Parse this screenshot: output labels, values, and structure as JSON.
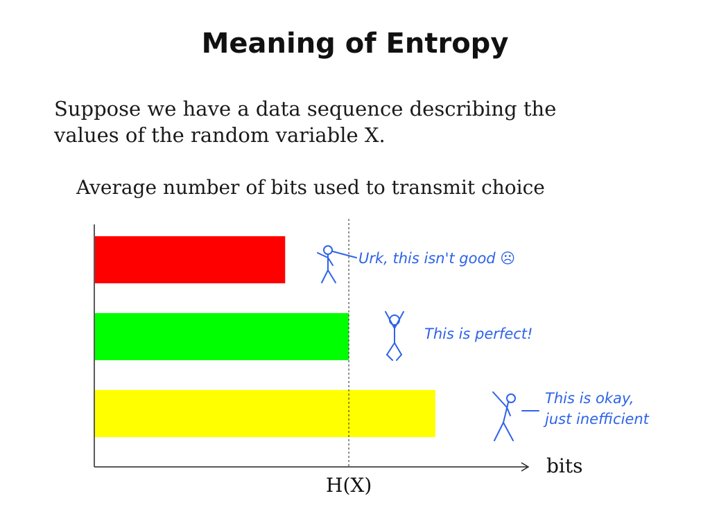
{
  "slide": {
    "title": "Meaning of Entropy",
    "intro_lines": [
      "Suppose we have a data sequence describing the",
      "values of the random variable X."
    ]
  },
  "chart_data": {
    "type": "bar",
    "orientation": "horizontal",
    "title": "Average number of bits used to transmit choice",
    "xlabel": "bits",
    "ylabel": "",
    "xlim": [
      0,
      1.7
    ],
    "reference_line": {
      "label": "H(X)",
      "value": 1.0,
      "style": "dashed"
    },
    "bars": [
      {
        "value": 0.75,
        "color": "#ff0000",
        "annotation": [
          "Urk, this isn't good ☹"
        ]
      },
      {
        "value": 1.0,
        "color": "#00ff00",
        "annotation": [
          "This is perfect!"
        ]
      },
      {
        "value": 1.34,
        "color": "#ffff00",
        "annotation": [
          "This is okay,",
          "just inefficient"
        ]
      }
    ],
    "grid": false,
    "legend": "none",
    "annotation_color": "#2d63e8"
  }
}
